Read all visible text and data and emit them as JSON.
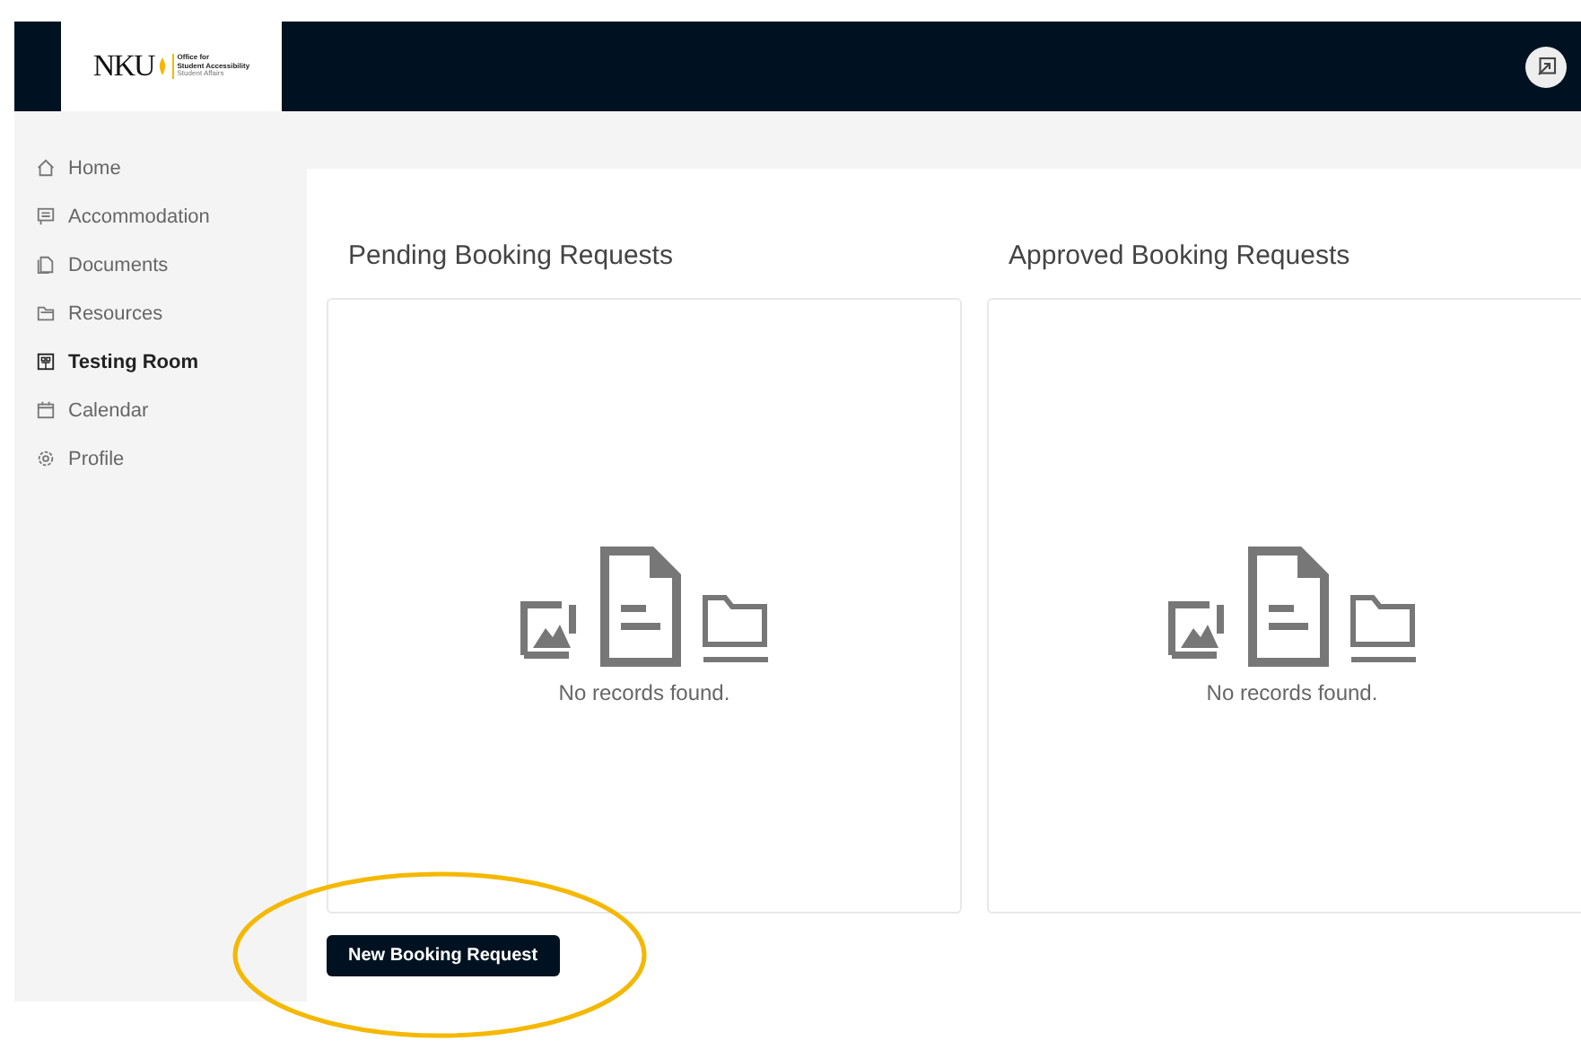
{
  "logo": {
    "wordmark": "NKU",
    "lines": [
      "Office for",
      "Student Accessibility",
      "Student Affairs"
    ]
  },
  "sidebar": {
    "items": [
      {
        "label": "Home",
        "kind": "home",
        "selected": false
      },
      {
        "label": "Accommodation",
        "kind": "message",
        "selected": false
      },
      {
        "label": "Documents",
        "kind": "document",
        "selected": false
      },
      {
        "label": "Resources",
        "kind": "folder",
        "selected": false
      },
      {
        "label": "Testing Room",
        "kind": "building",
        "selected": true
      },
      {
        "label": "Calendar",
        "kind": "calendar",
        "selected": false
      },
      {
        "label": "Profile",
        "kind": "gear",
        "selected": false
      }
    ]
  },
  "panels": [
    {
      "title": "Pending Booking Requests",
      "empty_text": "No records found."
    },
    {
      "title": "Approved Booking Requests",
      "empty_text": "No records found."
    }
  ],
  "new_button": {
    "label": "New Booking Request"
  },
  "annotation": {
    "kind": "ellipse",
    "color": "#f5b800"
  }
}
